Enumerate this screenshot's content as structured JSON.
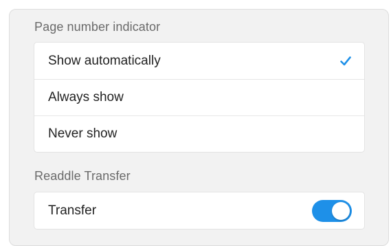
{
  "page_indicator": {
    "header": "Page number indicator",
    "options": [
      {
        "label": "Show automatically",
        "selected": true
      },
      {
        "label": "Always show",
        "selected": false
      },
      {
        "label": "Never show",
        "selected": false
      }
    ]
  },
  "transfer": {
    "header": "Readdle Transfer",
    "row_label": "Transfer",
    "enabled": true
  },
  "colors": {
    "accent": "#1e90e8",
    "panel_bg": "#f2f2f2"
  },
  "icons": {
    "selected_marker": "checkmark-icon"
  }
}
